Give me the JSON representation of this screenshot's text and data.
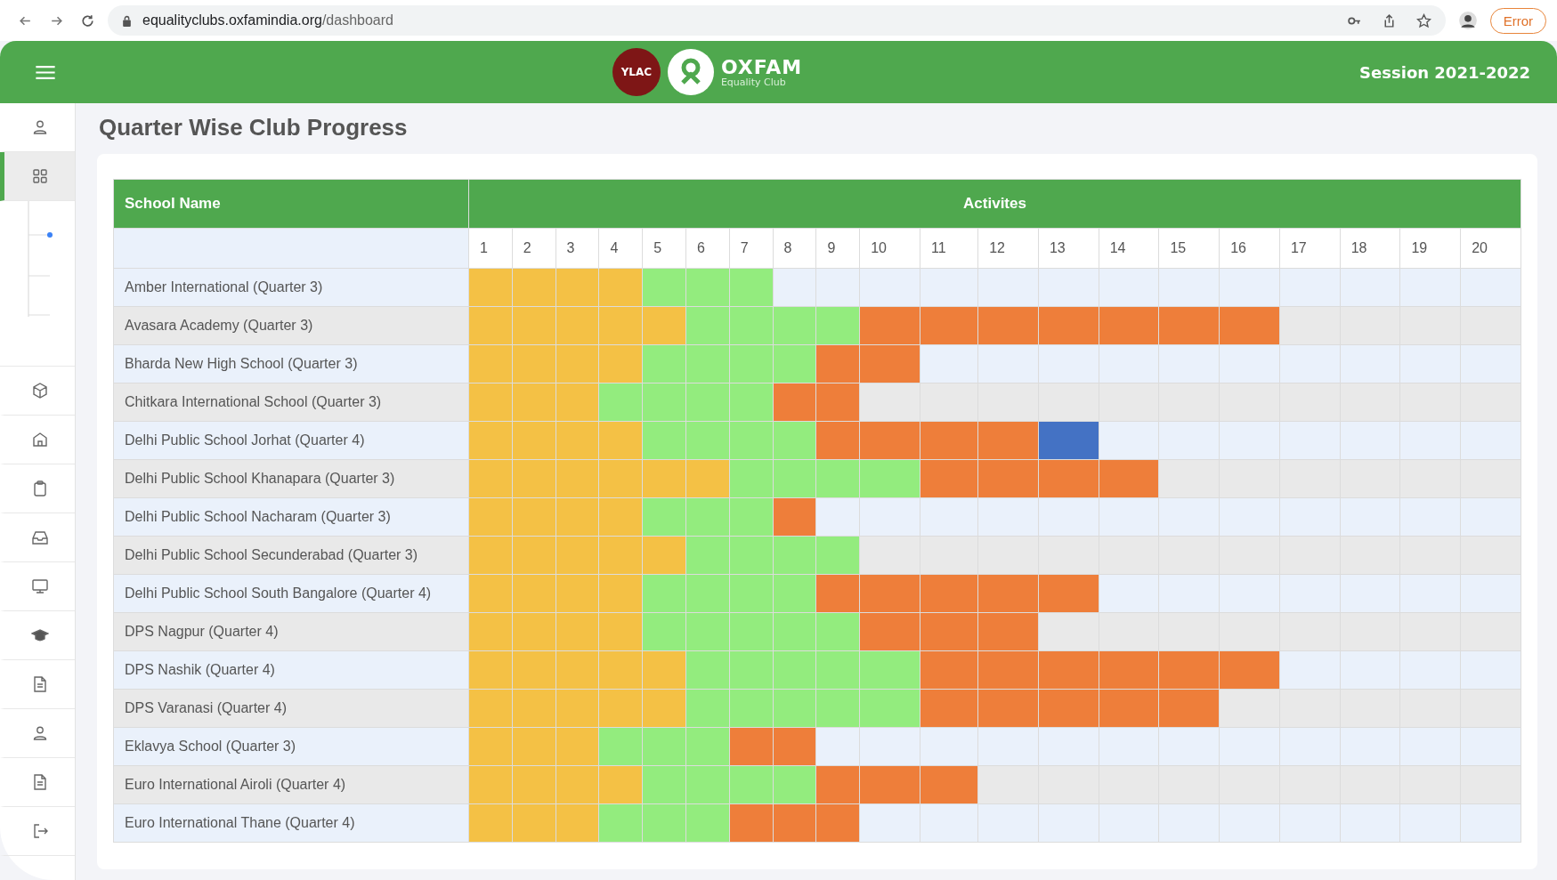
{
  "browser": {
    "url_host": "equalityclubs.oxfamindia.org",
    "url_path": "/dashboard",
    "error_button": "Error"
  },
  "header": {
    "ylac_logo": "YLAC",
    "brand_name": "OXFAM",
    "brand_sub": "Equality Club",
    "session": "Session 2021-2022"
  },
  "sidebar": {
    "items": [
      {
        "selected": false
      },
      {
        "selected": true
      },
      {
        "selected": false
      },
      {
        "selected": false
      },
      {
        "selected": false
      },
      {
        "selected": false
      },
      {
        "selected": false
      },
      {
        "selected": false
      },
      {
        "selected": false
      },
      {
        "selected": false
      },
      {
        "selected": false
      },
      {
        "selected": false
      }
    ]
  },
  "page_title": "Quarter Wise Club Progress",
  "table": {
    "school_header": "School Name",
    "activities_header": "Activites",
    "columns": [
      "1",
      "2",
      "3",
      "4",
      "5",
      "6",
      "7",
      "8",
      "9",
      "10",
      "11",
      "12",
      "13",
      "14",
      "15",
      "16",
      "17",
      "18",
      "19",
      "20"
    ],
    "rows": [
      {
        "school": "Amber International (Quarter 3)",
        "cells": [
          {
            "color": "#f4c145"
          },
          {
            "color": "#f4c145"
          },
          {
            "color": "#f4c145"
          },
          {
            "color": "#f4c145"
          },
          {
            "color": "#93ec7e"
          },
          {
            "color": "#93ec7e"
          },
          {
            "color": "#93ec7e"
          }
        ]
      },
      {
        "school": "Avasara Academy (Quarter 3)",
        "cells": [
          {
            "color": "#f4c145"
          },
          {
            "color": "#f4c145"
          },
          {
            "color": "#f4c145"
          },
          {
            "color": "#f4c145"
          },
          {
            "color": "#f4c145"
          },
          {
            "color": "#93ec7e"
          },
          {
            "color": "#93ec7e"
          },
          {
            "color": "#93ec7e"
          },
          {
            "color": "#93ec7e"
          },
          {
            "color": "#ee7e3a"
          },
          {
            "color": "#ee7e3a"
          },
          {
            "color": "#ee7e3a"
          },
          {
            "color": "#ee7e3a"
          },
          {
            "color": "#ee7e3a"
          },
          {
            "color": "#ee7e3a"
          },
          {
            "color": "#ee7e3a"
          }
        ]
      },
      {
        "school": "Bharda New High School (Quarter 3)",
        "cells": [
          {
            "color": "#f4c145"
          },
          {
            "color": "#f4c145"
          },
          {
            "color": "#f4c145"
          },
          {
            "color": "#f4c145"
          },
          {
            "color": "#93ec7e"
          },
          {
            "color": "#93ec7e"
          },
          {
            "color": "#93ec7e"
          },
          {
            "color": "#93ec7e"
          },
          {
            "color": "#ee7e3a"
          },
          {
            "color": "#ee7e3a"
          }
        ]
      },
      {
        "school": "Chitkara International School (Quarter 3)",
        "cells": [
          {
            "color": "#f4c145"
          },
          {
            "color": "#f4c145"
          },
          {
            "color": "#f4c145"
          },
          {
            "color": "#93ec7e"
          },
          {
            "color": "#93ec7e"
          },
          {
            "color": "#93ec7e"
          },
          {
            "color": "#93ec7e"
          },
          {
            "color": "#ee7e3a"
          },
          {
            "color": "#ee7e3a"
          }
        ]
      },
      {
        "school": "Delhi Public School Jorhat (Quarter 4)",
        "cells": [
          {
            "color": "#f4c145"
          },
          {
            "color": "#f4c145"
          },
          {
            "color": "#f4c145"
          },
          {
            "color": "#f4c145"
          },
          {
            "color": "#93ec7e"
          },
          {
            "color": "#93ec7e"
          },
          {
            "color": "#93ec7e"
          },
          {
            "color": "#93ec7e"
          },
          {
            "color": "#ee7e3a"
          },
          {
            "color": "#ee7e3a"
          },
          {
            "color": "#ee7e3a"
          },
          {
            "color": "#ee7e3a"
          },
          {
            "color": "#4472c4"
          }
        ]
      },
      {
        "school": "Delhi Public School Khanapara (Quarter 3)",
        "cells": [
          {
            "color": "#f4c145"
          },
          {
            "color": "#f4c145"
          },
          {
            "color": "#f4c145"
          },
          {
            "color": "#f4c145"
          },
          {
            "color": "#f4c145"
          },
          {
            "color": "#f4c145"
          },
          {
            "color": "#93ec7e"
          },
          {
            "color": "#93ec7e"
          },
          {
            "color": "#93ec7e"
          },
          {
            "color": "#93ec7e"
          },
          {
            "color": "#ee7e3a"
          },
          {
            "color": "#ee7e3a"
          },
          {
            "color": "#ee7e3a"
          },
          {
            "color": "#ee7e3a"
          }
        ]
      },
      {
        "school": "Delhi Public School Nacharam (Quarter 3)",
        "cells": [
          {
            "color": "#f4c145"
          },
          {
            "color": "#f4c145"
          },
          {
            "color": "#f4c145"
          },
          {
            "color": "#f4c145"
          },
          {
            "color": "#93ec7e"
          },
          {
            "color": "#93ec7e"
          },
          {
            "color": "#93ec7e"
          },
          {
            "color": "#ee7e3a"
          }
        ]
      },
      {
        "school": "Delhi Public School Secunderabad (Quarter 3)",
        "cells": [
          {
            "color": "#f4c145"
          },
          {
            "color": "#f4c145"
          },
          {
            "color": "#f4c145"
          },
          {
            "color": "#f4c145"
          },
          {
            "color": "#f4c145"
          },
          {
            "color": "#93ec7e"
          },
          {
            "color": "#93ec7e"
          },
          {
            "color": "#93ec7e"
          },
          {
            "color": "#93ec7e"
          }
        ]
      },
      {
        "school": "Delhi Public School South Bangalore (Quarter 4)",
        "cells": [
          {
            "color": "#f4c145"
          },
          {
            "color": "#f4c145"
          },
          {
            "color": "#f4c145"
          },
          {
            "color": "#f4c145"
          },
          {
            "color": "#93ec7e"
          },
          {
            "color": "#93ec7e"
          },
          {
            "color": "#93ec7e"
          },
          {
            "color": "#93ec7e"
          },
          {
            "color": "#ee7e3a"
          },
          {
            "color": "#ee7e3a"
          },
          {
            "color": "#ee7e3a"
          },
          {
            "color": "#ee7e3a"
          },
          {
            "color": "#ee7e3a"
          }
        ]
      },
      {
        "school": "DPS Nagpur (Quarter 4)",
        "cells": [
          {
            "color": "#f4c145"
          },
          {
            "color": "#f4c145"
          },
          {
            "color": "#f4c145"
          },
          {
            "color": "#f4c145"
          },
          {
            "color": "#93ec7e"
          },
          {
            "color": "#93ec7e"
          },
          {
            "color": "#93ec7e"
          },
          {
            "color": "#93ec7e"
          },
          {
            "color": "#93ec7e"
          },
          {
            "color": "#ee7e3a"
          },
          {
            "color": "#ee7e3a"
          },
          {
            "color": "#ee7e3a"
          }
        ]
      },
      {
        "school": "DPS Nashik (Quarter 4)",
        "cells": [
          {
            "color": "#f4c145"
          },
          {
            "color": "#f4c145"
          },
          {
            "color": "#f4c145"
          },
          {
            "color": "#f4c145"
          },
          {
            "color": "#f4c145"
          },
          {
            "color": "#93ec7e"
          },
          {
            "color": "#93ec7e"
          },
          {
            "color": "#93ec7e"
          },
          {
            "color": "#93ec7e"
          },
          {
            "color": "#93ec7e"
          },
          {
            "color": "#ee7e3a"
          },
          {
            "color": "#ee7e3a"
          },
          {
            "color": "#ee7e3a"
          },
          {
            "color": "#ee7e3a"
          },
          {
            "color": "#ee7e3a"
          },
          {
            "color": "#ee7e3a"
          }
        ]
      },
      {
        "school": "DPS Varanasi (Quarter 4)",
        "cells": [
          {
            "color": "#f4c145"
          },
          {
            "color": "#f4c145"
          },
          {
            "color": "#f4c145"
          },
          {
            "color": "#f4c145"
          },
          {
            "color": "#f4c145"
          },
          {
            "color": "#93ec7e"
          },
          {
            "color": "#93ec7e"
          },
          {
            "color": "#93ec7e"
          },
          {
            "color": "#93ec7e"
          },
          {
            "color": "#93ec7e"
          },
          {
            "color": "#ee7e3a"
          },
          {
            "color": "#ee7e3a"
          },
          {
            "color": "#ee7e3a"
          },
          {
            "color": "#ee7e3a"
          },
          {
            "color": "#ee7e3a"
          }
        ]
      },
      {
        "school": "Eklavya School (Quarter 3)",
        "cells": [
          {
            "color": "#f4c145"
          },
          {
            "color": "#f4c145"
          },
          {
            "color": "#f4c145"
          },
          {
            "color": "#93ec7e"
          },
          {
            "color": "#93ec7e"
          },
          {
            "color": "#93ec7e"
          },
          {
            "color": "#ee7e3a"
          },
          {
            "color": "#ee7e3a"
          }
        ]
      },
      {
        "school": "Euro International Airoli (Quarter 4)",
        "cells": [
          {
            "color": "#f4c145"
          },
          {
            "color": "#f4c145"
          },
          {
            "color": "#f4c145"
          },
          {
            "color": "#f4c145"
          },
          {
            "color": "#93ec7e"
          },
          {
            "color": "#93ec7e"
          },
          {
            "color": "#93ec7e"
          },
          {
            "color": "#93ec7e"
          },
          {
            "color": "#ee7e3a"
          },
          {
            "color": "#ee7e3a"
          },
          {
            "color": "#ee7e3a"
          }
        ]
      },
      {
        "school": "Euro International Thane (Quarter 4)",
        "cells": [
          {
            "color": "#f4c145"
          },
          {
            "color": "#f4c145"
          },
          {
            "color": "#f4c145"
          },
          {
            "color": "#93ec7e"
          },
          {
            "color": "#93ec7e"
          },
          {
            "color": "#93ec7e"
          },
          {
            "color": "#ee7e3a"
          },
          {
            "color": "#ee7e3a"
          },
          {
            "color": "#ee7e3a"
          }
        ]
      }
    ]
  }
}
